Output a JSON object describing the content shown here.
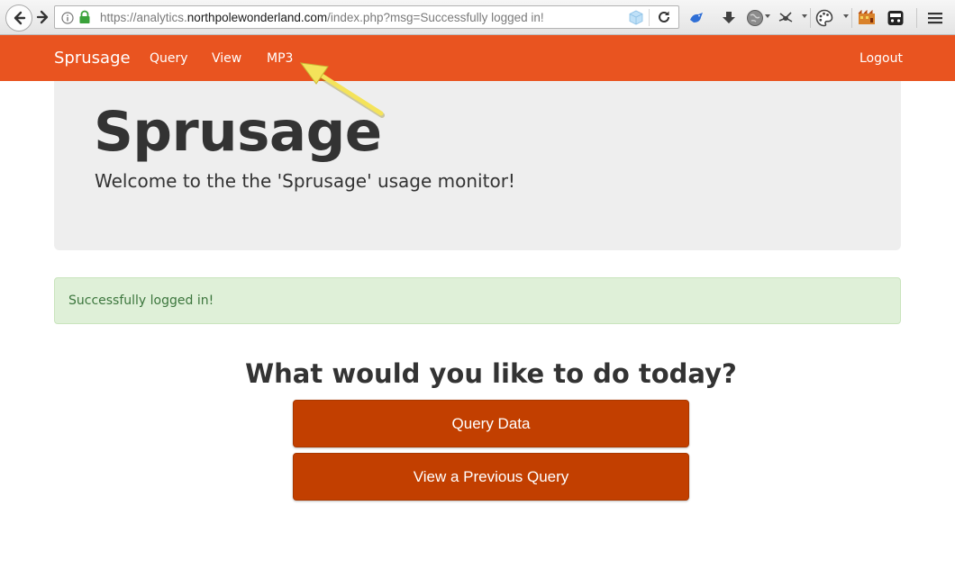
{
  "browser": {
    "url_prefix": "https://analytics.",
    "url_host": "northpolewonderland.com",
    "url_suffix": "/index.php?msg=Successfully logged in!",
    "icons": [
      "back-icon",
      "forward-icon",
      "info-icon",
      "lock-icon",
      "cube-icon",
      "reload-icon",
      "bird-icon",
      "download-icon",
      "globe-icon",
      "bug-icon",
      "palette-icon",
      "extension-icon",
      "reader-icon",
      "menu-icon"
    ]
  },
  "navbar": {
    "brand": "Sprusage",
    "links": [
      "Query",
      "View",
      "MP3"
    ],
    "logout": "Logout",
    "color": "#e95420"
  },
  "jumbotron": {
    "title": "Sprusage",
    "subtitle": "Welcome to the the 'Sprusage' usage monitor!"
  },
  "alert": {
    "text": "Successfully logged in!"
  },
  "main": {
    "question": "What would you like to do today?",
    "buttons": [
      "Query Data",
      "View a Previous Query"
    ],
    "button_color": "#c23f00"
  }
}
